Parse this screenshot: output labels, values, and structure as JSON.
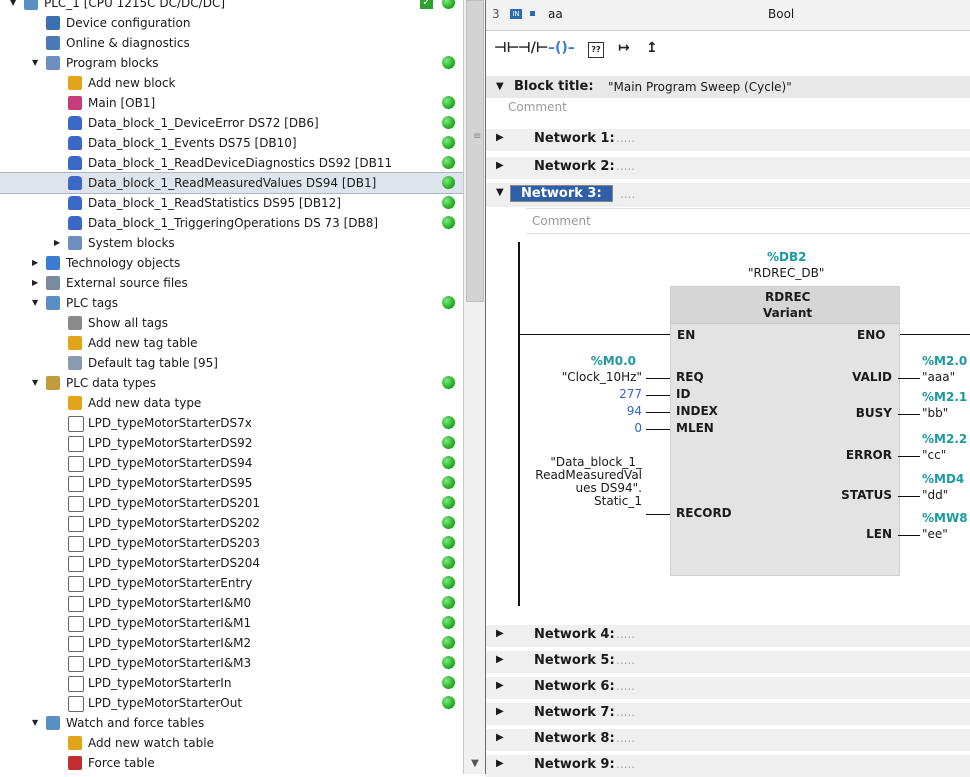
{
  "tree": [
    {
      "label": "PLC_1 [CPU 1215C DC/DC/DC]",
      "indent": 0,
      "arrow": "down",
      "icon": "plc-icon",
      "status": "ok-check"
    },
    {
      "label": "Device configuration",
      "indent": 1,
      "arrow": "",
      "icon": "device-config-icon",
      "status": ""
    },
    {
      "label": "Online & diagnostics",
      "indent": 1,
      "arrow": "",
      "icon": "diagnostics-icon",
      "status": ""
    },
    {
      "label": "Program blocks",
      "indent": 1,
      "arrow": "down",
      "icon": "folder-icon",
      "status": "ok"
    },
    {
      "label": "Add new block",
      "indent": 2,
      "arrow": "",
      "icon": "add-icon",
      "status": ""
    },
    {
      "label": "Main [OB1]",
      "indent": 2,
      "arrow": "",
      "icon": "ob-block-icon",
      "status": "ok"
    },
    {
      "label": "Data_block_1_DeviceError DS72 [DB6]",
      "indent": 2,
      "arrow": "",
      "icon": "db-icon",
      "status": "ok"
    },
    {
      "label": "Data_block_1_Events DS75 [DB10]",
      "indent": 2,
      "arrow": "",
      "icon": "db-icon",
      "status": "ok"
    },
    {
      "label": "Data_block_1_ReadDeviceDiagnostics DS92 [DB11",
      "indent": 2,
      "arrow": "",
      "icon": "db-icon",
      "status": "ok"
    },
    {
      "label": "Data_block_1_ReadMeasuredValues DS94 [DB1]",
      "indent": 2,
      "arrow": "",
      "icon": "db-icon",
      "status": "ok",
      "selected": true
    },
    {
      "label": "Data_block_1_ReadStatistics DS95 [DB12]",
      "indent": 2,
      "arrow": "",
      "icon": "db-icon",
      "status": "ok"
    },
    {
      "label": "Data_block_1_TriggeringOperations DS 73 [DB8]",
      "indent": 2,
      "arrow": "",
      "icon": "db-icon",
      "status": "ok"
    },
    {
      "label": "System blocks",
      "indent": 2,
      "arrow": "right",
      "icon": "folder-icon",
      "status": ""
    },
    {
      "label": "Technology objects",
      "indent": 1,
      "arrow": "right",
      "icon": "technology-icon",
      "status": ""
    },
    {
      "label": "External source files",
      "indent": 1,
      "arrow": "right",
      "icon": "source-files-icon",
      "status": ""
    },
    {
      "label": "PLC tags",
      "indent": 1,
      "arrow": "down",
      "icon": "tags-folder-icon",
      "status": "ok"
    },
    {
      "label": "Show all tags",
      "indent": 2,
      "arrow": "",
      "icon": "tags-icon",
      "status": ""
    },
    {
      "label": "Add new tag table",
      "indent": 2,
      "arrow": "",
      "icon": "add-icon",
      "status": ""
    },
    {
      "label": "Default tag table [95]",
      "indent": 2,
      "arrow": "",
      "icon": "tag-table-icon",
      "status": ""
    },
    {
      "label": "PLC data types",
      "indent": 1,
      "arrow": "down",
      "icon": "datatype-folder-icon",
      "status": "ok"
    },
    {
      "label": "Add new data type",
      "indent": 2,
      "arrow": "",
      "icon": "add-icon",
      "status": ""
    },
    {
      "label": "LPD_typeMotorStarterDS7x",
      "indent": 2,
      "arrow": "",
      "icon": "datatype-icon",
      "status": "ok"
    },
    {
      "label": "LPD_typeMotorStarterDS92",
      "indent": 2,
      "arrow": "",
      "icon": "datatype-icon",
      "status": "ok"
    },
    {
      "label": "LPD_typeMotorStarterDS94",
      "indent": 2,
      "arrow": "",
      "icon": "datatype-icon",
      "status": "ok"
    },
    {
      "label": "LPD_typeMotorStarterDS95",
      "indent": 2,
      "arrow": "",
      "icon": "datatype-icon",
      "status": "ok"
    },
    {
      "label": "LPD_typeMotorStarterDS201",
      "indent": 2,
      "arrow": "",
      "icon": "datatype-icon",
      "status": "ok"
    },
    {
      "label": "LPD_typeMotorStarterDS202",
      "indent": 2,
      "arrow": "",
      "icon": "datatype-icon",
      "status": "ok"
    },
    {
      "label": "LPD_typeMotorStarterDS203",
      "indent": 2,
      "arrow": "",
      "icon": "datatype-icon",
      "status": "ok"
    },
    {
      "label": "LPD_typeMotorStarterDS204",
      "indent": 2,
      "arrow": "",
      "icon": "datatype-icon",
      "status": "ok"
    },
    {
      "label": "LPD_typeMotorStarterEntry",
      "indent": 2,
      "arrow": "",
      "icon": "datatype-icon",
      "status": "ok"
    },
    {
      "label": "LPD_typeMotorStarterI&M0",
      "indent": 2,
      "arrow": "",
      "icon": "datatype-icon",
      "status": "ok"
    },
    {
      "label": "LPD_typeMotorStarterI&M1",
      "indent": 2,
      "arrow": "",
      "icon": "datatype-icon",
      "status": "ok"
    },
    {
      "label": "LPD_typeMotorStarterI&M2",
      "indent": 2,
      "arrow": "",
      "icon": "datatype-icon",
      "status": "ok"
    },
    {
      "label": "LPD_typeMotorStarterI&M3",
      "indent": 2,
      "arrow": "",
      "icon": "datatype-icon",
      "status": "ok"
    },
    {
      "label": "LPD_typeMotorStarterIn",
      "indent": 2,
      "arrow": "",
      "icon": "datatype-icon",
      "status": "ok"
    },
    {
      "label": "LPD_typeMotorStarterOut",
      "indent": 2,
      "arrow": "",
      "icon": "datatype-icon",
      "status": "ok"
    },
    {
      "label": "Watch and force tables",
      "indent": 1,
      "arrow": "down",
      "icon": "watch-folder-icon",
      "status": ""
    },
    {
      "label": "Add new watch table",
      "indent": 2,
      "arrow": "",
      "icon": "add-icon",
      "status": ""
    },
    {
      "label": "Force table",
      "indent": 2,
      "arrow": "",
      "icon": "force-table-icon",
      "status": ""
    }
  ],
  "interface_row": {
    "num": "3",
    "name": "aa",
    "type": "Bool"
  },
  "toolbar": [
    "normally-open-contact-icon",
    "normally-closed-contact-icon",
    "coil-icon",
    "empty-box-icon",
    "open-branch-icon",
    "close-branch-icon"
  ],
  "block_title": {
    "label": "Block title:",
    "value": "\"Main Program Sweep (Cycle)\"",
    "comment": "Comment"
  },
  "networks_before": [
    {
      "title": "Network 1:",
      "desc": "....."
    },
    {
      "title": "Network 2:",
      "desc": "....."
    }
  ],
  "network3": {
    "title": "Network 3:",
    "desc": "....",
    "comment": "Comment",
    "instance_addr": "%DB2",
    "instance_name": "\"RDREC_DB\"",
    "block_name": "RDREC",
    "block_variant": "Variant",
    "en": "EN",
    "eno": "ENO",
    "inputs": [
      {
        "pin": "REQ",
        "addr": "%M0.0",
        "value": "\"Clock_10Hz\"",
        "kind": "tag"
      },
      {
        "pin": "ID",
        "addr": "",
        "value": "277",
        "kind": "const"
      },
      {
        "pin": "INDEX",
        "addr": "",
        "value": "94",
        "kind": "const"
      },
      {
        "pin": "MLEN",
        "addr": "",
        "value": "0",
        "kind": "const"
      },
      {
        "pin": "RECORD",
        "addr": "",
        "value": "\"Data_block_1_ ReadMeasuredVal ues DS94\". Static_1",
        "kind": "tag"
      }
    ],
    "outputs": [
      {
        "pin": "VALID",
        "addr": "%M2.0",
        "value": "\"aaa\""
      },
      {
        "pin": "BUSY",
        "addr": "%M2.1",
        "value": "\"bb\""
      },
      {
        "pin": "ERROR",
        "addr": "%M2.2",
        "value": "\"cc\""
      },
      {
        "pin": "STATUS",
        "addr": "%MD4",
        "value": "\"dd\""
      },
      {
        "pin": "LEN",
        "addr": "%MW8",
        "value": "\"ee\""
      }
    ]
  },
  "networks_after": [
    {
      "title": "Network 4:",
      "desc": "....."
    },
    {
      "title": "Network 5:",
      "desc": "....."
    },
    {
      "title": "Network 6:",
      "desc": "....."
    },
    {
      "title": "Network 7:",
      "desc": "....."
    },
    {
      "title": "Network 8:",
      "desc": "....."
    },
    {
      "title": "Network 9:",
      "desc": "....."
    }
  ],
  "colors": {
    "ok_green": "#1aa61a",
    "address_teal": "#1b9aa0",
    "constant_blue": "#3465c8",
    "selection": "#dde4ec"
  }
}
